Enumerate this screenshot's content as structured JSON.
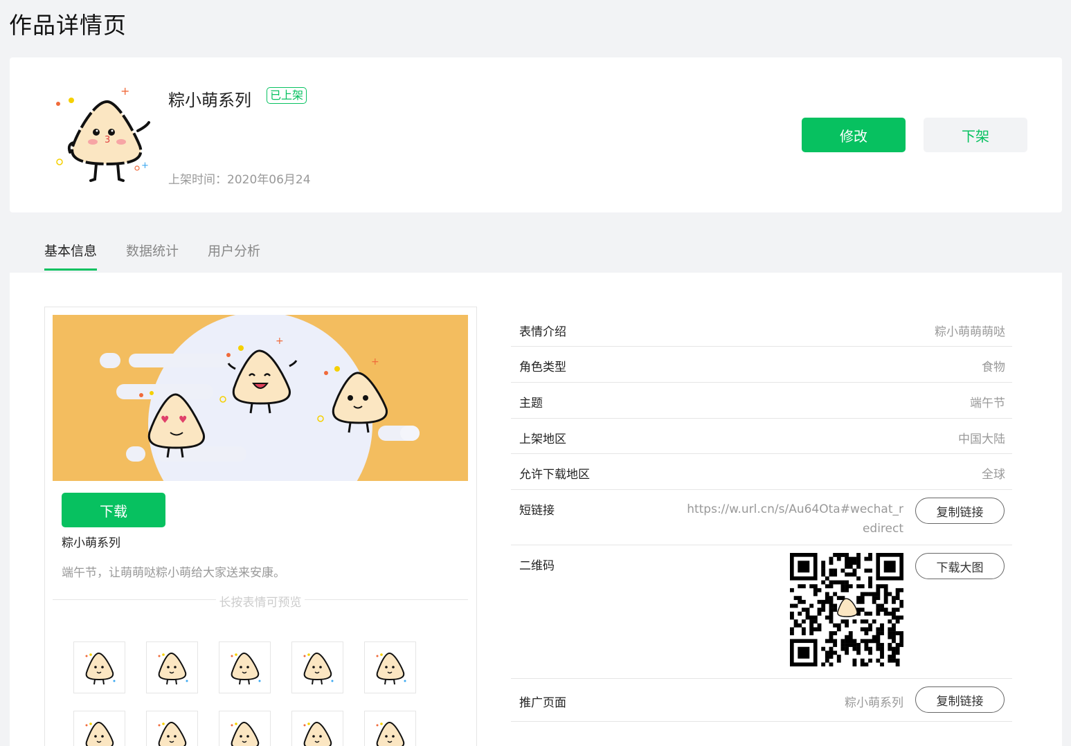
{
  "page": {
    "title": "作品详情页"
  },
  "work": {
    "name": "粽小萌系列",
    "status": "已上架",
    "publish_time": "上架时间：2020年06月24",
    "edit_label": "修改",
    "offline_label": "下架"
  },
  "tabs": [
    {
      "label": "基本信息",
      "active": true
    },
    {
      "label": "数据统计",
      "active": false
    },
    {
      "label": "用户分析",
      "active": false
    }
  ],
  "preview": {
    "download_label": "下载",
    "name": "粽小萌系列",
    "description": "端午节，让萌萌哒粽小萌给大家送来安康。",
    "hint": "长按表情可预览",
    "sticker_icons": [
      "smile-sticker-icon",
      "grin-sticker-icon",
      "laugh-sticker-icon",
      "happy-sticker-icon",
      "shy-sticker-icon",
      "smile2-sticker-icon",
      "angry-sticker-icon",
      "surprised-sticker-icon",
      "cry-sticker-icon",
      "sweat-sticker-icon"
    ]
  },
  "info": {
    "intro": {
      "label": "表情介绍",
      "value": "粽小萌萌萌哒"
    },
    "role_type": {
      "label": "角色类型",
      "value": "食物"
    },
    "theme": {
      "label": "主题",
      "value": "端午节"
    },
    "region": {
      "label": "上架地区",
      "value": "中国大陆"
    },
    "download_region": {
      "label": "允许下载地区",
      "value": "全球"
    },
    "short_link": {
      "label": "短链接",
      "value_line1": "https://w.url.cn/s/Au64Ota#wechat_r",
      "value_line2": "edirect",
      "button": "复制链接"
    },
    "qrcode": {
      "label": "二维码",
      "button": "下载大图"
    },
    "promo": {
      "label": "推广页面",
      "value": "粽小萌系列",
      "button": "复制链接"
    }
  },
  "colors": {
    "accent": "#07c160",
    "banner": "#f3bd5f",
    "background": "#f2f3f5"
  }
}
